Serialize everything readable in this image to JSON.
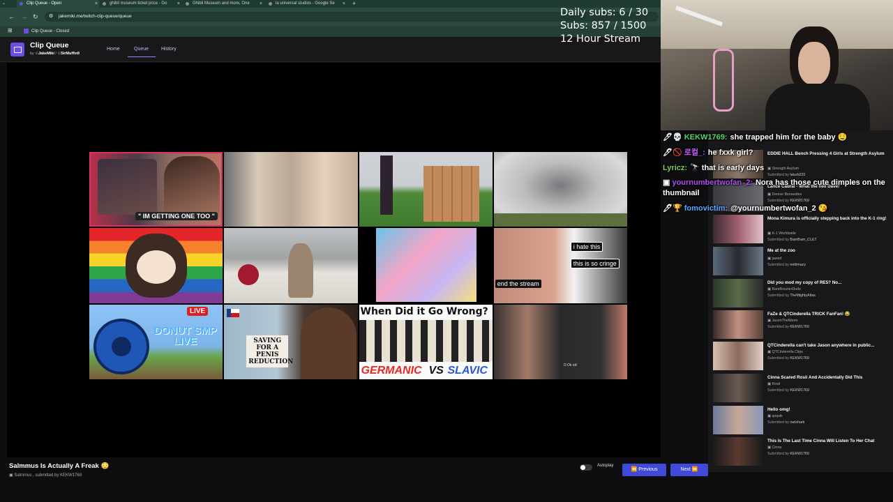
{
  "browser": {
    "tabs": [
      {
        "title": "Clip Queue - Open",
        "active": true
      },
      {
        "title": "ghibli museum ticket price - Go",
        "active": false
      },
      {
        "title": "Ghibli Museum and more, One",
        "active": false
      },
      {
        "title": "la universal studios - Google Se",
        "active": false
      }
    ],
    "new_tab": "+",
    "url": "jakemiki.me/twitch-clip-queue/queue",
    "bookmark": "Clip Queue - Closed"
  },
  "app": {
    "title": "Clip Queue",
    "by_prefix": "by",
    "author1": "JakeMiki",
    "separator": "/",
    "author2": "SirMuffin9",
    "nav": [
      "Home",
      "Queue",
      "History"
    ],
    "active_nav": "Queue"
  },
  "stream_overlay": {
    "daily_subs": "Daily subs: 6 / 30",
    "subs": "Subs: 857 / 1500",
    "stream": "12 Hour Stream"
  },
  "thumbnail_captions": {
    "c1": "\" IM GETTING ONE TOO \"",
    "c7_1": "i hate this",
    "c7_2": "this is so cringe",
    "c7_3": "end the stream",
    "c8": "DONUT SMP LIVE",
    "c8_live": "LIVE",
    "c9": "SAVING FOR A PENIS REDUCTION",
    "c10_top": "When Did it Go Wrong?",
    "c10_left": "GERMANIC",
    "c10_vs": "VS",
    "c10_right": "SLAVIC",
    "c11": "O.Ok ok!"
  },
  "current_clip": {
    "title": "Salmmus Is Actually A Freak 😳",
    "channel": "Salmmus",
    "submitted": ", submitted by KEKW1769"
  },
  "controls": {
    "autoplay": "Autoplay",
    "previous": "Previous",
    "next": "Next"
  },
  "queue": [
    {
      "title": "EDDIE HALL Bench Pressing 4 Girls at Strength Asylum",
      "channel": "Strength Asylum",
      "submitter": "laturb222"
    },
    {
      "title": "Lance Cabral - What the hell Dave!",
      "channel": "Denise Benavides",
      "submitter": "KEKW1769"
    },
    {
      "title": "Mona Kimura is officially stepping back into the K-1 ring!",
      "channel": "K-1 Worldwide",
      "submitter": "BamBam_CULT"
    },
    {
      "title": "Me at the zoo",
      "channel": "jawed",
      "submitter": "nettimacy"
    },
    {
      "title": "Did you mod my copy of RE5? No...",
      "channel": "BamBoozlerDude",
      "submitter": "TheMightyAtlas"
    },
    {
      "title": "FaZe & QTCinderella TRICK FanFan! 😂",
      "channel": "JasonTheWeen",
      "submitter": "KEKW1769"
    },
    {
      "title": "QTCinderella can't take Jason anywhere in public...",
      "channel": "QTCinderella Clips",
      "submitter": "KEKW1769"
    },
    {
      "title": "Cinna Scared Rosii And Accidentally Did This",
      "channel": "Rosii",
      "submitter": "KEKW1769"
    },
    {
      "title": "Hello omg!",
      "channel": "qoqsik",
      "submitter": "owlshark"
    },
    {
      "title": "This Is The Last Time Cinna Will Listen To Her Chat",
      "channel": "Cinna",
      "submitter": "KEKW1769"
    }
  ],
  "queue_submitted_prefix": "Submitted by",
  "chat": [
    {
      "user": "KEKW1769:",
      "color": "#52d66b",
      "badges": "🖊💀",
      "message": "she trapped him for the baby 🤤"
    },
    {
      "user": "로컬_:",
      "color": "#c05cff",
      "badges": "🖊🚫",
      "message": "he fxxk girl?"
    },
    {
      "user": "Lyricz:",
      "color": "#7ccf5a",
      "badges": "",
      "message": "🔭 that is early days"
    },
    {
      "user": "yournumbertwofan_2:",
      "color": "#b04df0",
      "badges": "▣",
      "message": "Nora has those cute dimples on the thumbnail"
    },
    {
      "user": "fomovictim:",
      "color": "#5aa8ff",
      "badges": "🖊🏆",
      "message": "@yournumbertwofan_2 😘"
    }
  ]
}
